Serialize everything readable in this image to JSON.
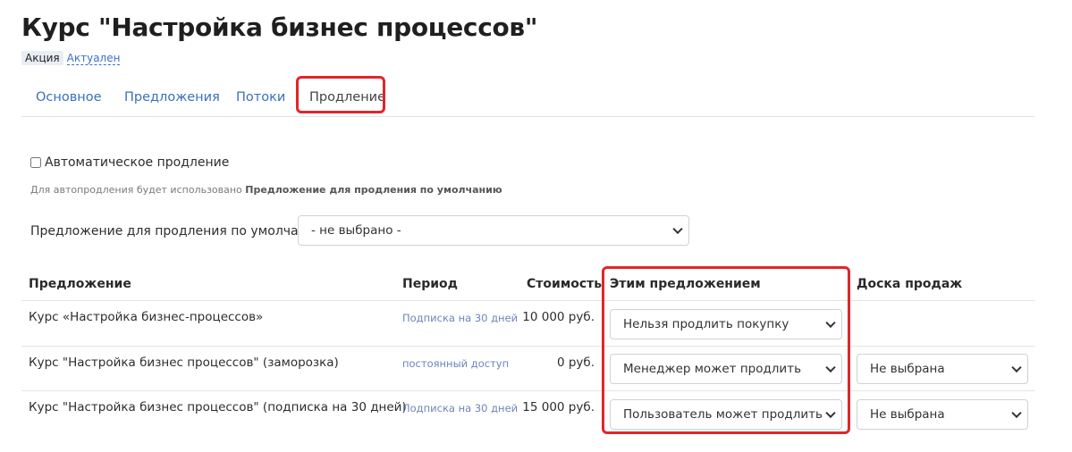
{
  "page": {
    "title": "Курс \"Настройка бизнес процессов\"",
    "tag_promo": "Акция",
    "tag_status": "Актуален"
  },
  "tabs": [
    {
      "label": "Основное"
    },
    {
      "label": "Предложения"
    },
    {
      "label": "Потоки"
    },
    {
      "label": "Продление",
      "active": true
    }
  ],
  "settings": {
    "auto_renew_label": "Автоматическое продление",
    "auto_renew_checked": false,
    "hint_prefix": "Для автопродления будет использовано",
    "hint_bold": "Предложение для продления по умолчанию",
    "default_offer_label": "Предложение для продления по умолчанию:",
    "default_offer_value": "- не выбрано -"
  },
  "table": {
    "headers": {
      "offer": "Предложение",
      "period": "Период",
      "cost": "Стоимость",
      "action": "Этим предложением",
      "board": "Доска продаж"
    },
    "rows": [
      {
        "name": "Курс «Настройка бизнес-процессов»",
        "period": "Подписка на 30 дней",
        "cost": "10 000 руб.",
        "action": "Нельзя продлить покупку",
        "board": ""
      },
      {
        "name": "Курс \"Настройка бизнес процессов\" (заморозка)",
        "period": "постоянный доступ",
        "cost": "0 руб.",
        "action": "Менеджер может продлить",
        "board": "Не выбрана"
      },
      {
        "name": "Курс \"Настройка бизнес процессов\" (подписка на 30 дней)",
        "period": "Подписка на 30 дней",
        "cost": "15 000 руб.",
        "action": "Пользователь может продлить",
        "board": "Не выбрана"
      }
    ]
  },
  "colors": {
    "highlight": "#e0262b",
    "link": "#3a6fbf"
  }
}
